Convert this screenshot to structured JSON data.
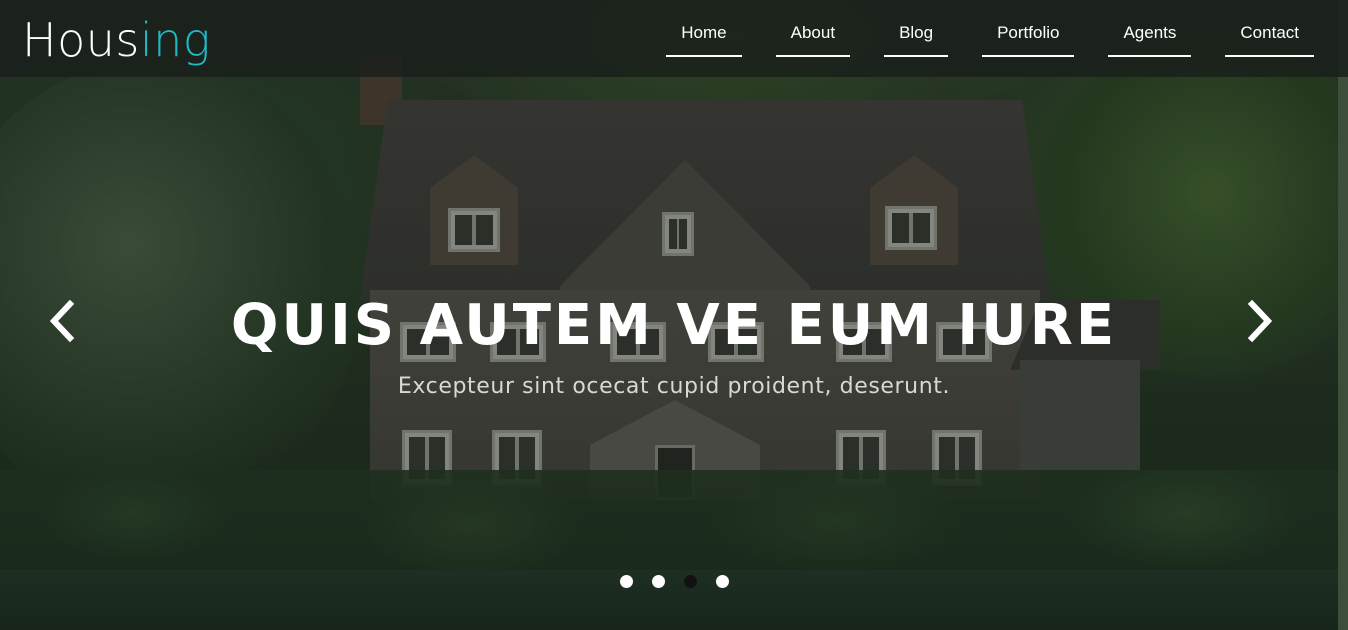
{
  "brand": {
    "logo_part1": "Hous",
    "logo_part2": "ing",
    "accent_color": "#1fb8c4"
  },
  "nav": {
    "items": [
      {
        "label": "Home"
      },
      {
        "label": "About"
      },
      {
        "label": "Blog"
      },
      {
        "label": "Portfolio"
      },
      {
        "label": "Agents"
      },
      {
        "label": "Contact"
      }
    ]
  },
  "slider": {
    "headline": "QUIS AUTEM VE EUM IURE",
    "subline": "Excepteur sint ocecat cupid proident, deserunt.",
    "prev_icon": "chevron-left-icon",
    "next_icon": "chevron-right-icon",
    "dot_count": 4,
    "active_dot": 3
  }
}
